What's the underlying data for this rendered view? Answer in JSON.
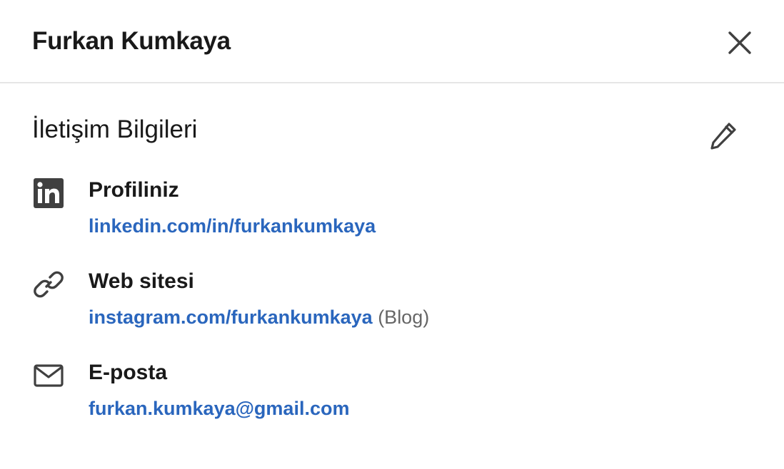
{
  "header": {
    "title": "Furkan Kumkaya",
    "close_icon": "close-icon"
  },
  "section": {
    "title": "İletişim Bilgileri",
    "edit_icon": "pencil-icon"
  },
  "items": [
    {
      "icon": "linkedin-icon",
      "label": "Profiliniz",
      "value": "linkedin.com/in/furkankumkaya",
      "suffix": ""
    },
    {
      "icon": "link-icon",
      "label": "Web sitesi",
      "value": "instagram.com/furkankumkaya",
      "suffix": "(Blog)"
    },
    {
      "icon": "mail-icon",
      "label": "E-posta",
      "value": "furkan.kumkaya@gmail.com",
      "suffix": ""
    }
  ],
  "colors": {
    "link": "#2a66bd",
    "text": "#191919",
    "muted": "#666666",
    "divider": "#e6e6e6",
    "icon": "#404040"
  }
}
